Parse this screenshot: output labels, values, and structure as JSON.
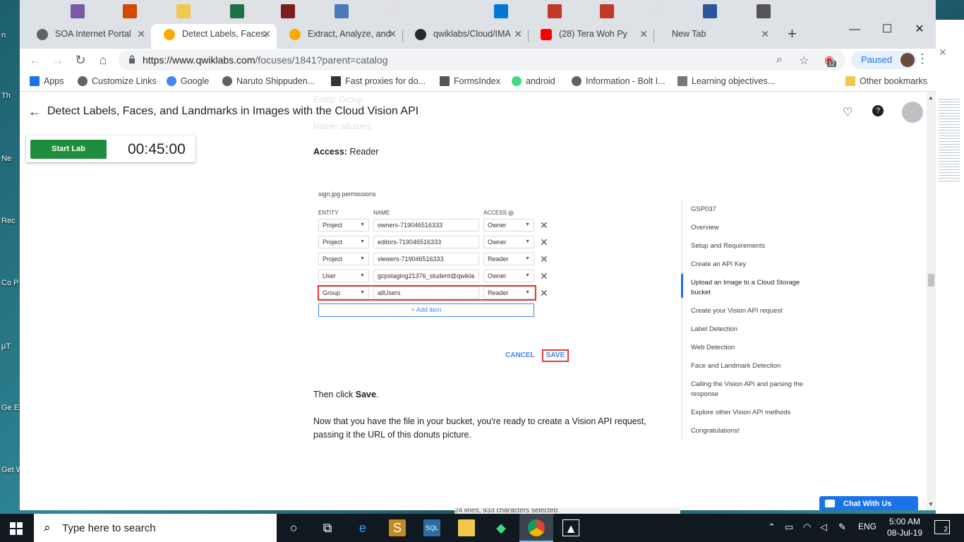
{
  "desktop": {
    "side_labels": [
      "n",
      "Th",
      "Ne",
      "Rec",
      "Co P",
      "µT",
      "Ge Exp",
      "Get With"
    ]
  },
  "browser": {
    "tabs": [
      {
        "title": "SOA Internet Portal",
        "favicon": "globe-icon",
        "color": "#5f6368"
      },
      {
        "title": "Detect Labels, Faces,",
        "favicon": "qwiklabs-icon",
        "color": "#f9ab00",
        "active": true
      },
      {
        "title": "Extract, Analyze, and",
        "favicon": "qwiklabs-icon",
        "color": "#f9ab00"
      },
      {
        "title": "qwiklabs/Cloud/IMA",
        "favicon": "github-icon",
        "color": "#24292e"
      },
      {
        "title": "(28) Tera Woh Py",
        "favicon": "youtube-icon",
        "color": "#ff0000"
      },
      {
        "title": "New Tab",
        "favicon": "",
        "color": ""
      }
    ],
    "url_host": "https://www.qwiklabs.com",
    "url_path": "/focuses/1841?parent=catalog",
    "profile_label": "Paused",
    "extension_badge": "12",
    "bookmarks": [
      {
        "label": "Apps",
        "icon": "apps-grid-icon",
        "color": "#1a73e8"
      },
      {
        "label": "Customize Links",
        "icon": "globe-icon",
        "color": "#5f6368"
      },
      {
        "label": "Google",
        "icon": "google-icon",
        "color": "#4285f4"
      },
      {
        "label": "Naruto Shippuden...",
        "icon": "globe-icon",
        "color": "#5f6368"
      },
      {
        "label": "Fast proxies for do...",
        "icon": "proxy-icon",
        "color": "#333"
      },
      {
        "label": "FormsIndex",
        "icon": "forms-icon",
        "color": "#555"
      },
      {
        "label": "android",
        "icon": "android-icon",
        "color": "#3ddc84"
      },
      {
        "label": "Information - Bolt I...",
        "icon": "globe-icon",
        "color": "#5f6368"
      },
      {
        "label": "Learning objectives...",
        "icon": "course-icon",
        "color": "#777"
      }
    ],
    "other_bookmarks": "Other bookmarks"
  },
  "page": {
    "title": "Detect Labels, Faces, and Landmarks in Images with the Cloud Vision API",
    "ghost_entity": "Entity: Group",
    "ghost_name": "Name: allUsers",
    "start_lab": "Start Lab",
    "timer": "00:45:00",
    "access_label": "Access:",
    "access_value": "Reader",
    "then_click_prefix": "Then click ",
    "then_click_bold": "Save",
    "then_click_suffix": ".",
    "paragraph": "Now that you have the file in your bucket, you're ready to create a Vision API request, passing it the URL of this donuts picture.",
    "chat": "Chat With Us"
  },
  "permissions": {
    "title": "sign.jpg permissions",
    "headers": {
      "entity": "ENTITY",
      "name": "NAME",
      "access": "ACCESS"
    },
    "rows": [
      {
        "entity": "Project",
        "name": "owners-719046516333",
        "access": "Owner"
      },
      {
        "entity": "Project",
        "name": "editors-719046516333",
        "access": "Owner"
      },
      {
        "entity": "Project",
        "name": "viewers-719046516333",
        "access": "Reader"
      },
      {
        "entity": "User",
        "name": "gcpstaging21376_student@qwikla",
        "access": "Owner"
      },
      {
        "entity": "Group",
        "name": "allUsers",
        "access": "Reader"
      }
    ],
    "add_item": "Add item",
    "cancel": "CANCEL",
    "save": "SAVE"
  },
  "toc": [
    "GSP037",
    "Overview",
    "Setup and Requirements",
    "Create an API Key",
    "Upload an Image to a Cloud Storage bucket",
    "Create your Vision API request",
    "Label Detection",
    "Web Detection",
    "Face and Landmark Detection",
    "Calling the Vision API and parsing the response",
    "Explore other Vision API methods",
    "Congratulations!"
  ],
  "taskbar": {
    "search_placeholder": "Type here to search",
    "language": "ENG",
    "time": "5:00 AM",
    "date": "08-Jul-19",
    "notification_count": "2"
  },
  "background_text": "24 lines, 933 characters selected"
}
